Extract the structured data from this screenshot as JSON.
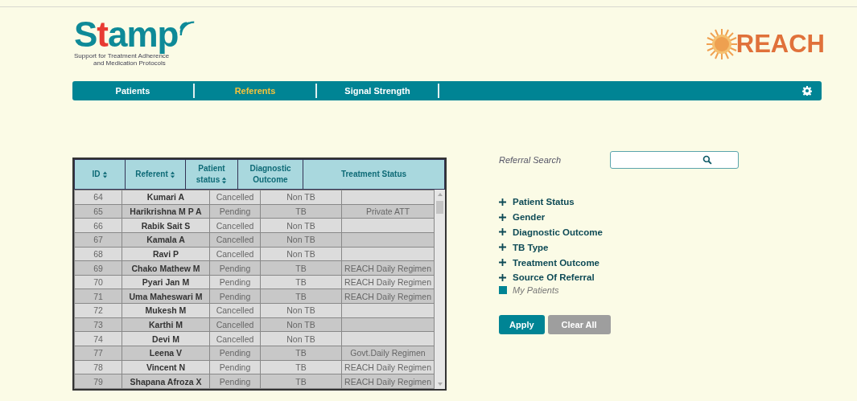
{
  "logo": {
    "name": "Stamp",
    "tagline": [
      "Support for Treatment Adherence",
      "and Medication Protocols"
    ]
  },
  "partner_logo": {
    "name": "REACH"
  },
  "nav": {
    "tabs": [
      {
        "label": "Patients",
        "selected": false
      },
      {
        "label": "Referents",
        "selected": true
      },
      {
        "label": "Signal Strength",
        "selected": false
      }
    ]
  },
  "table": {
    "columns": [
      "ID",
      "Referent",
      "Patient status",
      "Diagnostic Outcome",
      "Treatment Status"
    ],
    "sortable": [
      true,
      true,
      true,
      false,
      false
    ],
    "rows": [
      [
        "64",
        "Kumari A",
        "Cancelled",
        "Non TB",
        ""
      ],
      [
        "65",
        "Harikrishna M P A",
        "Pending",
        "TB",
        "Private ATT"
      ],
      [
        "66",
        "Rabik Sait S",
        "Cancelled",
        "Non TB",
        ""
      ],
      [
        "67",
        "Kamala A",
        "Cancelled",
        "Non TB",
        ""
      ],
      [
        "68",
        "Ravi P",
        "Cancelled",
        "Non TB",
        ""
      ],
      [
        "69",
        "Chako Mathew M",
        "Pending",
        "TB",
        "REACH Daily Regimen"
      ],
      [
        "70",
        "Pyari Jan M",
        "Pending",
        "TB",
        "REACH Daily Regimen"
      ],
      [
        "71",
        "Uma Maheswari M",
        "Pending",
        "TB",
        "REACH Daily Regimen"
      ],
      [
        "72",
        "Mukesh M",
        "Cancelled",
        "Non TB",
        ""
      ],
      [
        "73",
        "Karthi M",
        "Cancelled",
        "Non TB",
        ""
      ],
      [
        "74",
        "Devi M",
        "Cancelled",
        "Non TB",
        ""
      ],
      [
        "77",
        "Leena V",
        "Pending",
        "TB",
        "Govt.Daily Regimen"
      ],
      [
        "78",
        "Vincent N",
        "Pending",
        "TB",
        "REACH Daily Regimen"
      ],
      [
        "79",
        "Shapana Afroza X",
        "Pending",
        "TB",
        "REACH Daily Regimen"
      ]
    ]
  },
  "search": {
    "label": "Referral Search"
  },
  "filters": [
    {
      "label": "Patient Status",
      "expanded": false
    },
    {
      "label": "Gender",
      "expanded": false
    },
    {
      "label": "Diagnostic Outcome",
      "expanded": false
    },
    {
      "label": "TB Type",
      "expanded": false
    },
    {
      "label": "Treatment Outcome",
      "expanded": false
    },
    {
      "label": "Source Of Referral",
      "expanded": false
    }
  ],
  "my_patients": {
    "label": "My Patients",
    "checked": true
  },
  "buttons": [
    {
      "label": "Apply",
      "disabled": false
    },
    {
      "label": "Clear All",
      "disabled": true
    }
  ]
}
